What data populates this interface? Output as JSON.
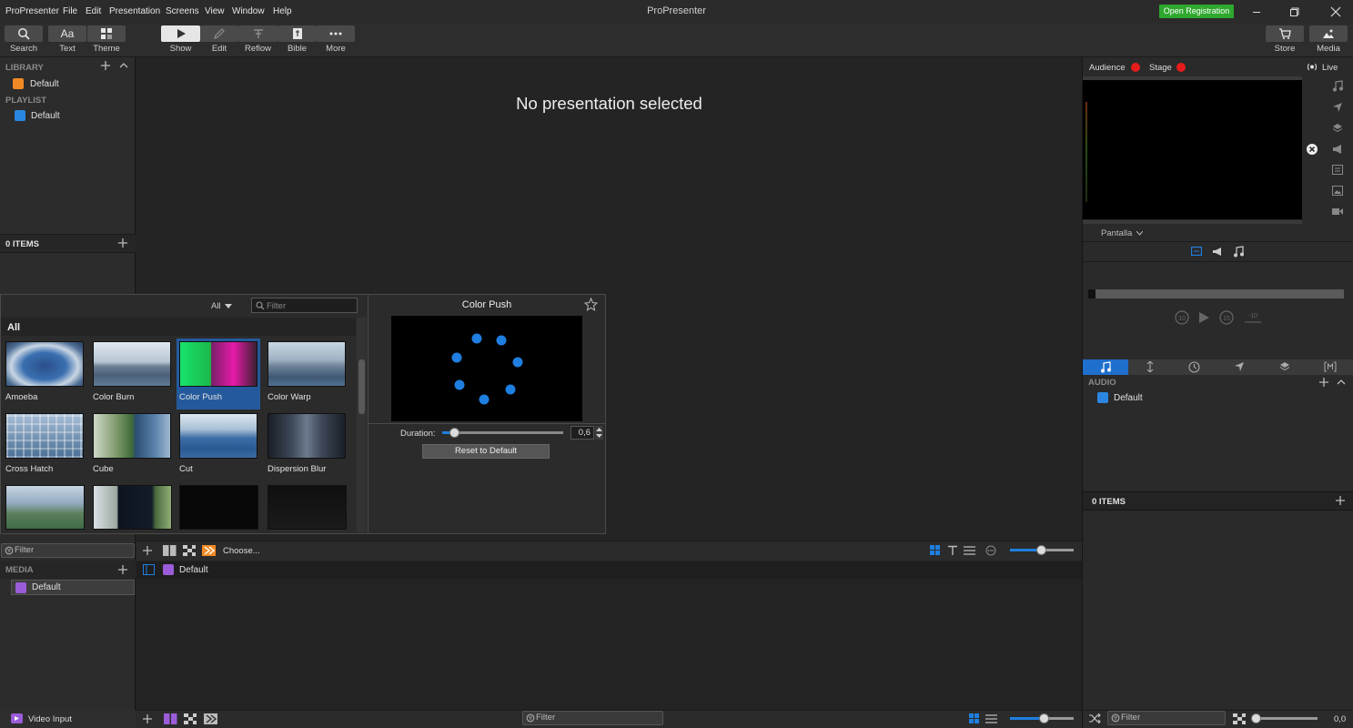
{
  "app": {
    "title": "ProPresenter",
    "registration_label": "Open Registration"
  },
  "menu": [
    "ProPresenter",
    "File",
    "Edit",
    "Presentation",
    "Screens",
    "View",
    "Window",
    "Help"
  ],
  "toolbar": {
    "left": [
      {
        "label": "Search",
        "icon": "search-icon"
      },
      {
        "label": "Text",
        "icon": "text-icon"
      },
      {
        "label": "Theme",
        "icon": "theme-icon"
      }
    ],
    "modes": [
      {
        "label": "Show",
        "icon": "play-icon"
      },
      {
        "label": "Edit",
        "icon": "pencil-icon"
      },
      {
        "label": "Reflow",
        "icon": "reflow-icon"
      },
      {
        "label": "Bible",
        "icon": "bible-icon"
      },
      {
        "label": "More",
        "icon": "more-icon"
      }
    ],
    "right": [
      {
        "label": "Store",
        "icon": "cart-icon"
      },
      {
        "label": "Media",
        "icon": "media-icon"
      }
    ]
  },
  "library": {
    "header": "LIBRARY",
    "item": "Default",
    "playlist_header": "PLAYLIST",
    "playlist_item": "Default",
    "items_count": "0 ITEMS"
  },
  "main": {
    "empty_message": "No presentation selected"
  },
  "transitions": {
    "category_select": "All",
    "filter_placeholder": "Filter",
    "group_label": "All",
    "items": [
      "Amoeba",
      "Color Burn",
      "Color Push",
      "Color Warp",
      "Cross Hatch",
      "Cube",
      "Cut",
      "Dispersion Blur"
    ],
    "selected": "Color Push",
    "preview_title": "Color Push",
    "duration_label": "Duration:",
    "duration_value": "0,6",
    "duration_fraction": 0.1,
    "reset_label": "Reset to Default"
  },
  "media_bin": {
    "filter_label": "Filter",
    "choose_label": "Choose...",
    "media_header": "MEDIA",
    "media_item": "Default",
    "playlist_item": "Default",
    "video_input_label": "Video Input",
    "bottom_filter": "Filter"
  },
  "right": {
    "audience_label": "Audience",
    "stage_label": "Stage",
    "live_label": "Live",
    "screen_select": "Pantalla",
    "audio_header": "AUDIO",
    "audio_item": "Default",
    "items_count": "0 ITEMS",
    "filter_label": "Filter",
    "volume_value": "0,0",
    "transport": {
      "back_label": "10",
      "fwd_label": "15",
      "minus_label": "-10"
    }
  },
  "colors": {
    "accent": "#1f7fe0",
    "registration": "#2ea82e",
    "live_dot": "#e51c1c",
    "media_purple": "#9a5cd8",
    "library_orange": "#f08a24"
  }
}
